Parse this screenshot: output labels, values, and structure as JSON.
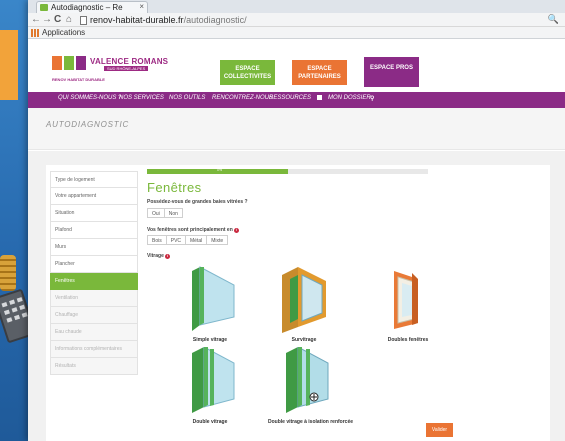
{
  "browser": {
    "tab_title": "Autodiagnostic – Re",
    "url_host": "renov-habitat-durable.fr",
    "url_path": "/autodiagnostic/",
    "bookmarks_label": "Applications"
  },
  "header": {
    "logo_line1": "VALENCE ROMANS",
    "logo_line2": "SUD RHÔNE-ALPES",
    "logo_line3": "RENOV HABITAT DURABLE",
    "espace_collectivites": "ESPACE COLLECTIVITES",
    "espace_partenaires": "ESPACE PARTENAIRES",
    "espace_pros": "ESPACE PROS",
    "colors": {
      "green": "#7ab83b",
      "orange": "#ea7434",
      "purple": "#8b2b86"
    }
  },
  "nav": {
    "items": [
      "QUI SOMMES-NOUS ?",
      "NOS SERVICES",
      "NOS OUTILS",
      "RENCONTREZ-NOUS",
      "RESSOURCES",
      "MON DOSSIER"
    ],
    "search_icon": "search-icon"
  },
  "page": {
    "title": "AUTODIAGNOSTIC"
  },
  "sidebar": {
    "items": [
      {
        "label": "Type de logement",
        "state": "normal"
      },
      {
        "label": "Votre appartement",
        "state": "normal"
      },
      {
        "label": "Situation",
        "state": "normal"
      },
      {
        "label": "Plafond",
        "state": "normal"
      },
      {
        "label": "Murs",
        "state": "normal"
      },
      {
        "label": "Plancher",
        "state": "normal"
      },
      {
        "label": "Fenêtres",
        "state": "active"
      },
      {
        "label": "Ventilation",
        "state": "muted"
      },
      {
        "label": "Chauffage",
        "state": "muted"
      },
      {
        "label": "Eau chaude",
        "state": "muted"
      },
      {
        "label": "Informations complémentaires",
        "state": "muted"
      },
      {
        "label": "Résultats",
        "state": "muted"
      }
    ]
  },
  "form": {
    "progress_label": "0%",
    "progress_fraction": 0.5,
    "step_title": "Fenêtres",
    "q1": "Possédez-vous de grandes baies vitrées ?",
    "q1_options": [
      "Oui",
      "Non"
    ],
    "q2": "Vos fenêtres sont principalement en",
    "q2_options": [
      "Bois",
      "PVC",
      "Métal",
      "Mixte"
    ],
    "q3": "Vitrage",
    "vitrages": [
      "Simple vitrage",
      "Survitrage",
      "Doubles fenêtres",
      "Double vitrage",
      "Double vitrage à isolation renforcée"
    ],
    "submit": "Valider"
  }
}
